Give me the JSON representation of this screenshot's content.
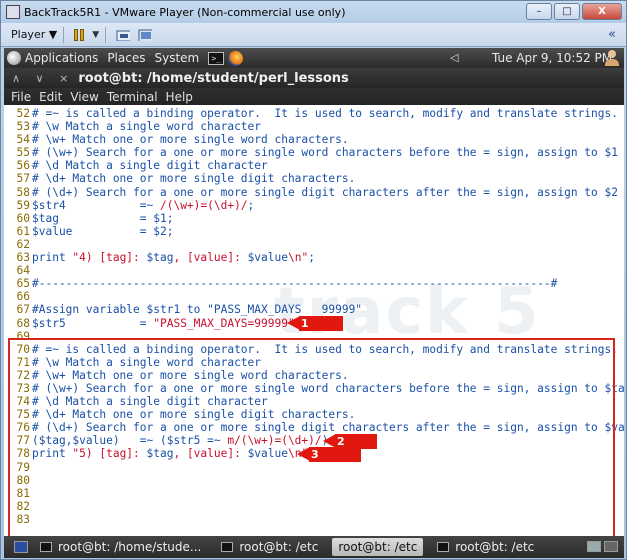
{
  "window": {
    "title": "BackTrack5R1 - VMware Player (Non-commercial use only)",
    "controls": [
      "–",
      "□",
      "X"
    ]
  },
  "toolbar": {
    "player_menu": "Player ▼",
    "chevron": "«"
  },
  "panel": {
    "menus": [
      "Applications",
      "Places",
      "System"
    ],
    "clock": "Tue Apr  9, 10:52 PM"
  },
  "terminal": {
    "title_buttons": "∧ ∨ ×",
    "title": "root@bt: /home/student/perl_lessons",
    "menus": [
      "File",
      "Edit",
      "View",
      "Terminal",
      "Help"
    ]
  },
  "editor": {
    "watermark": "track 5",
    "lines": [
      {
        "n": "52",
        "parts": [
          {
            "t": "# =~ is called a binding operator.  It is used to search, modify and translate strings."
          }
        ]
      },
      {
        "n": "53",
        "parts": [
          {
            "t": "# \\w Match a single word character"
          }
        ]
      },
      {
        "n": "54",
        "parts": [
          {
            "t": "# \\w+ Match one or more single word characters."
          }
        ]
      },
      {
        "n": "55",
        "parts": [
          {
            "t": "# (\\w+) Search for a one or more single word characters before the = sign, assign to $1"
          }
        ]
      },
      {
        "n": "56",
        "parts": [
          {
            "t": "# \\d Match a single digit character"
          }
        ]
      },
      {
        "n": "57",
        "parts": [
          {
            "t": "# \\d+ Match one or more single digit characters."
          }
        ]
      },
      {
        "n": "58",
        "parts": [
          {
            "t": "# (\\d+) Search for a one or more single digit characters after the = sign, assign to $2"
          }
        ]
      },
      {
        "n": "59",
        "parts": [
          {
            "t": "$str4           =~ "
          },
          {
            "t": "/(\\w+)=(\\d+)/",
            "c": "str"
          },
          {
            "t": ";"
          }
        ]
      },
      {
        "n": "60",
        "parts": [
          {
            "t": "$tag            = $1;"
          }
        ]
      },
      {
        "n": "61",
        "parts": [
          {
            "t": "$value          = $2;"
          }
        ]
      },
      {
        "n": "62",
        "parts": [
          {
            "t": ""
          }
        ]
      },
      {
        "n": "63",
        "parts": [
          {
            "t": "print "
          },
          {
            "t": "\"4) [tag]: ",
            "c": "str"
          },
          {
            "t": "$tag"
          },
          {
            "t": ", [value]: ",
            "c": "str"
          },
          {
            "t": "$value"
          },
          {
            "t": "\\n\"",
            "c": "str"
          },
          {
            "t": ";"
          }
        ]
      },
      {
        "n": "64",
        "parts": [
          {
            "t": ""
          }
        ]
      },
      {
        "n": "65",
        "parts": [
          {
            "t": "#----------------------------------------------------------------------------#"
          }
        ]
      },
      {
        "n": "66",
        "parts": [
          {
            "t": ""
          }
        ]
      },
      {
        "n": "67",
        "parts": [
          {
            "t": "#Assign variable $str1 to \"PASS_MAX_DAYS   99999\""
          }
        ]
      },
      {
        "n": "68",
        "parts": [
          {
            "t": "$str5           = "
          },
          {
            "t": "\"PASS_MAX_DAYS=99999\"",
            "c": "str"
          },
          {
            "t": ";"
          }
        ]
      },
      {
        "n": "69",
        "parts": [
          {
            "t": ""
          }
        ]
      },
      {
        "n": "70",
        "parts": [
          {
            "t": "# =~ is called a binding operator.  It is used to search, modify and translate strings."
          }
        ]
      },
      {
        "n": "71",
        "parts": [
          {
            "t": "# \\w Match a single word character"
          }
        ]
      },
      {
        "n": "72",
        "parts": [
          {
            "t": "# \\w+ Match one or more single word characters."
          }
        ]
      },
      {
        "n": "73",
        "parts": [
          {
            "t": "# (\\w+) Search for a one or more single word characters before the = sign, assign to $tag"
          }
        ]
      },
      {
        "n": "74",
        "parts": [
          {
            "t": "# \\d Match a single digit character"
          }
        ]
      },
      {
        "n": "75",
        "parts": [
          {
            "t": "# \\d+ Match one or more single digit characters."
          }
        ]
      },
      {
        "n": "76",
        "parts": [
          {
            "t": "# (\\d+) Search for a one or more single digit characters after the = sign, assign to $value"
          }
        ]
      },
      {
        "n": "77",
        "parts": [
          {
            "t": "($tag,$value)   =~ ($str5 =~ "
          },
          {
            "t": "m/(\\w+)=(\\d+)/",
            "c": "str"
          },
          {
            "t": ");"
          }
        ]
      },
      {
        "n": "78",
        "parts": [
          {
            "t": "print "
          },
          {
            "t": "\"5) [tag]: ",
            "c": "str"
          },
          {
            "t": "$tag"
          },
          {
            "t": ", [value]: ",
            "c": "str"
          },
          {
            "t": "$value"
          },
          {
            "t": "\\n\"",
            "c": "str"
          },
          {
            "t": ";"
          }
        ]
      },
      {
        "n": "79",
        "parts": [
          {
            "t": ""
          }
        ]
      },
      {
        "n": "80",
        "parts": [
          {
            "t": ""
          }
        ]
      },
      {
        "n": "81",
        "parts": [
          {
            "t": ""
          }
        ]
      },
      {
        "n": "82",
        "parts": [
          {
            "t": ""
          }
        ]
      },
      {
        "n": "83",
        "parts": [
          {
            "t": ""
          }
        ]
      }
    ]
  },
  "callouts": [
    {
      "num": "1",
      "line": "68"
    },
    {
      "num": "2",
      "line": "77"
    },
    {
      "num": "3",
      "line": "78"
    }
  ],
  "taskbar": {
    "tasks": [
      {
        "label": "root@bt: /home/stude...",
        "active": false
      },
      {
        "label": "root@bt: /etc",
        "active": false
      },
      {
        "label": "root@bt: /etc",
        "active": true
      },
      {
        "label": "root@bt: /etc",
        "active": false
      }
    ]
  },
  "colors": {
    "code": "#1a50a8",
    "string": "#c8102e",
    "line_number": "#8a6a00",
    "annotation": "#e01810"
  }
}
